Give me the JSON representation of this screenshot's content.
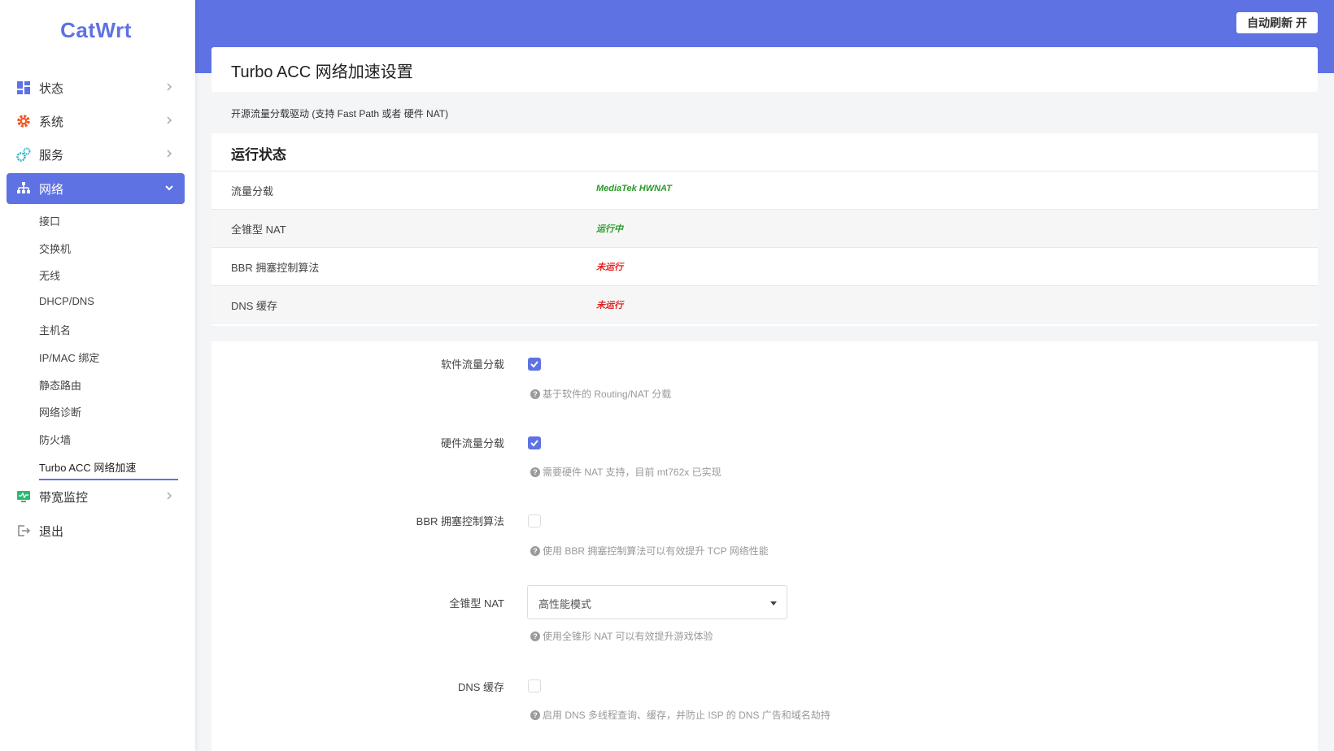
{
  "header": {
    "refresh_label": "自动刷新 开"
  },
  "sidebar": {
    "logo": "CatWrt",
    "items": [
      {
        "label": "状态",
        "icon": "dashboard-icon"
      },
      {
        "label": "系统",
        "icon": "gear-icon"
      },
      {
        "label": "服务",
        "icon": "gears-icon"
      },
      {
        "label": "网络",
        "icon": "network-icon"
      },
      {
        "label": "带宽监控",
        "icon": "monitor-icon"
      },
      {
        "label": "退出",
        "icon": "logout-icon"
      }
    ],
    "network_sub": [
      "接口",
      "交换机",
      "无线",
      "DHCP/DNS",
      "主机名",
      "IP/MAC 绑定",
      "静态路由",
      "网络诊断",
      "防火墙",
      "Turbo ACC 网络加速"
    ]
  },
  "page": {
    "title": "Turbo ACC 网络加速设置",
    "description": "开源流量分载驱动 (支持 Fast Path 或者 硬件 NAT)"
  },
  "status": {
    "title": "运行状态",
    "rows": [
      {
        "label": "流量分载",
        "value": "MediaTek HWNAT",
        "color": "#2a9a2a"
      },
      {
        "label": "全锥型 NAT",
        "value": "运行中",
        "color": "#2a9a2a"
      },
      {
        "label": "BBR 拥塞控制算法",
        "value": "未运行",
        "color": "#e02020"
      },
      {
        "label": "DNS 缓存",
        "value": "未运行",
        "color": "#e02020"
      }
    ]
  },
  "form": {
    "software_offload": {
      "label": "软件流量分载",
      "checked": true,
      "hint": "基于软件的 Routing/NAT 分载"
    },
    "hardware_offload": {
      "label": "硬件流量分载",
      "checked": true,
      "hint": "需要硬件 NAT 支持，目前 mt762x 已实现"
    },
    "bbr": {
      "label": "BBR 拥塞控制算法",
      "checked": false,
      "hint": "使用 BBR 拥塞控制算法可以有效提升 TCP 网络性能"
    },
    "fullcone": {
      "label": "全锥型 NAT",
      "value": "高性能模式",
      "hint": "使用全锥形 NAT 可以有效提升游戏体验"
    },
    "dns_cache": {
      "label": "DNS 缓存",
      "checked": false,
      "hint": "启用 DNS 多线程查询、缓存，并防止 ISP 的 DNS 广告和域名劫持"
    }
  },
  "colors": {
    "accent": "#5e72e4",
    "ok": "#2a9a2a",
    "bad": "#e02020"
  }
}
